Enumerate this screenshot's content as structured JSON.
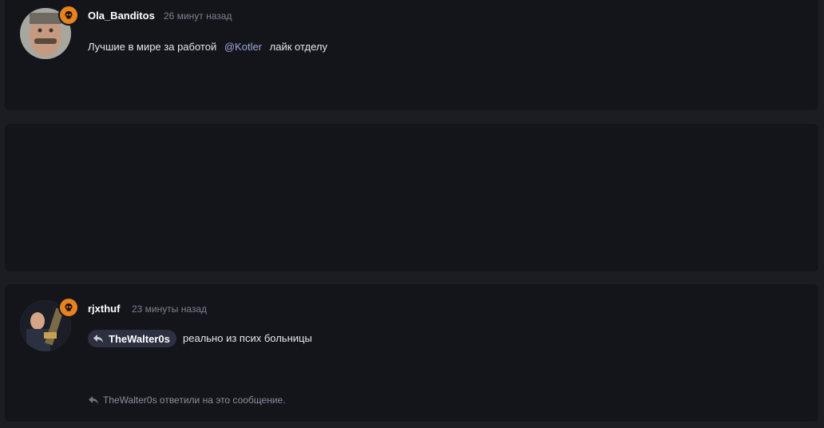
{
  "messages": [
    {
      "username": "Ola_Banditos",
      "timestamp": "26 минут назад",
      "text_before": "Лучшие в мире за работой",
      "mention": "@Kotler",
      "text_after": "лайк отделу",
      "avatar_icon": "user-avatar-photo",
      "badge_icon": "skull-icon"
    },
    {
      "username": "rjxthuf",
      "timestamp": "23 минуты назад",
      "reply_to": "TheWalter0s",
      "text": "реально из псих больницы",
      "replies_note": "TheWalter0s ответили на это сообщение.",
      "avatar_icon": "user-avatar-photo",
      "badge_icon": "skull-icon"
    }
  ],
  "colors": {
    "background": "#1c1d23",
    "card": "#14151b",
    "badge": "#e8821f",
    "mention": "#9ea6d8",
    "muted": "#7d8192",
    "chip": "#2d3040"
  }
}
